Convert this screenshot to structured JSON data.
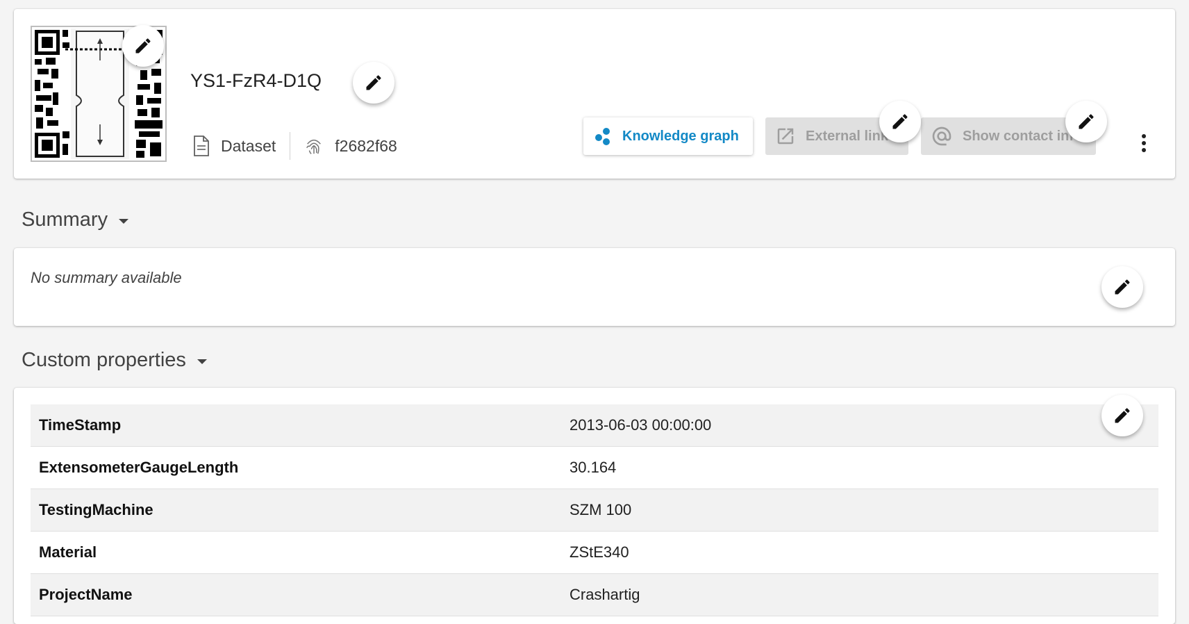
{
  "header": {
    "title": "YS1-FzR4-D1Q",
    "type_label": "Dataset",
    "id_label": "f2682f68",
    "buttons": {
      "knowledge_graph": "Knowledge graph",
      "external_links": "External links",
      "show_contact_info": "Show contact info"
    }
  },
  "summary": {
    "heading": "Summary",
    "text": "No summary available"
  },
  "custom_properties": {
    "heading": "Custom properties",
    "rows": [
      {
        "key": "TimeStamp",
        "value": "2013-06-03 00:00:00"
      },
      {
        "key": "ExtensometerGaugeLength",
        "value": "30.164"
      },
      {
        "key": "TestingMachine",
        "value": "SZM 100"
      },
      {
        "key": "Material",
        "value": "ZStE340"
      },
      {
        "key": "ProjectName",
        "value": "Crashartig"
      }
    ]
  },
  "colors": {
    "accent": "#1389c6",
    "disabled_bg": "#e0e0e0",
    "disabled_text": "#9e9e9e",
    "page_bg": "#f4f4f4"
  },
  "icons": [
    "pencil-icon",
    "document-icon",
    "fingerprint-icon",
    "knowledge-graph-icon",
    "external-link-icon",
    "at-sign-icon",
    "more-vert-icon",
    "caret-down-icon"
  ]
}
